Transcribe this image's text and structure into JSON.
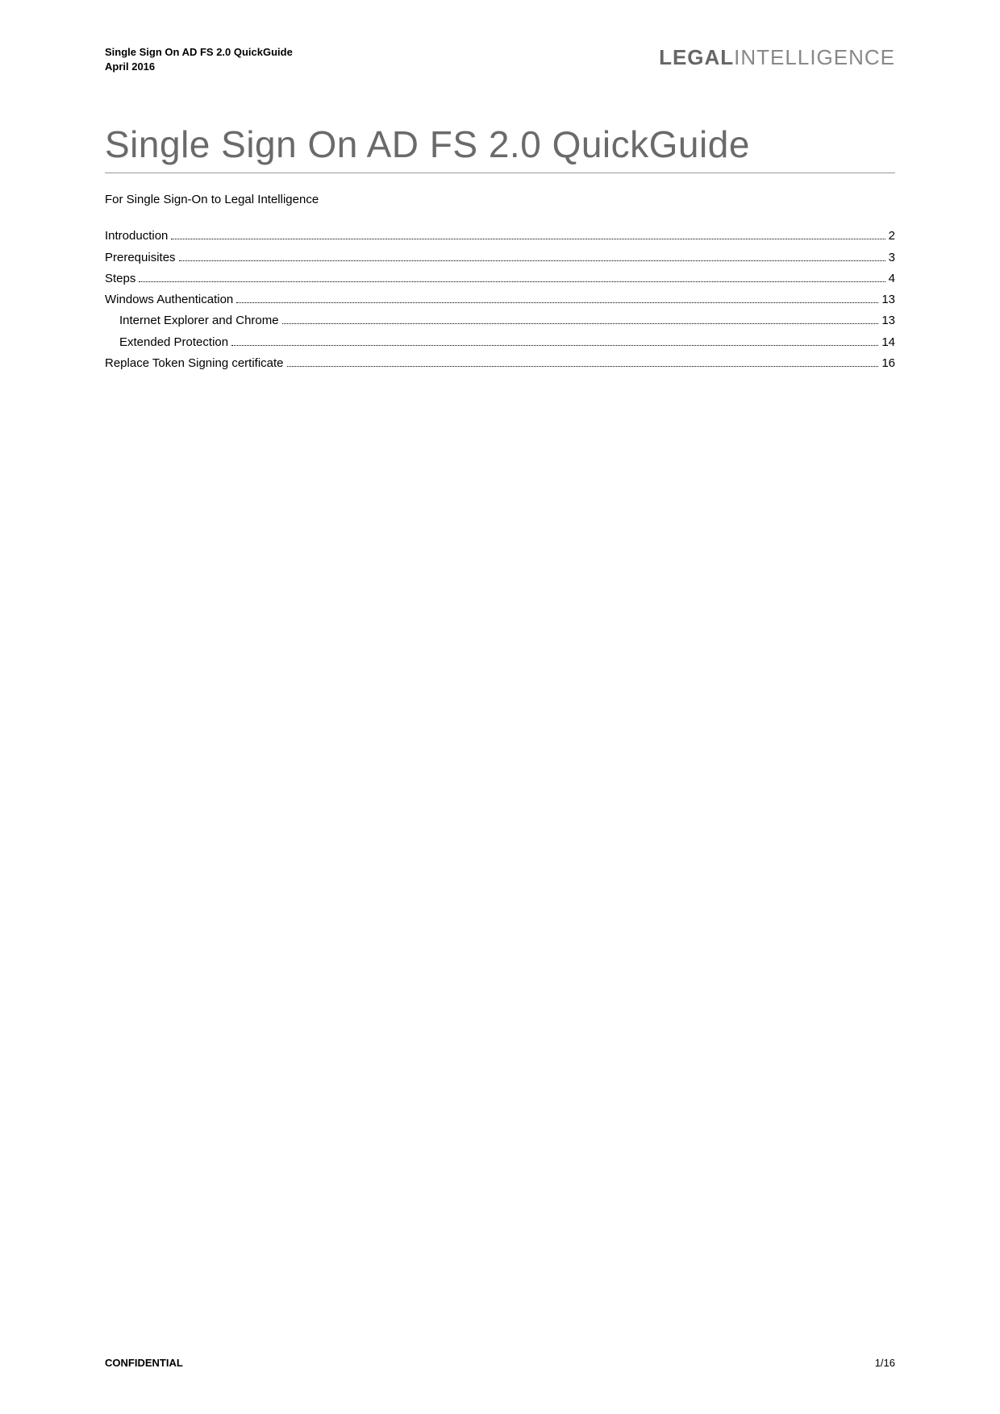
{
  "header": {
    "doc_title_line1": "Single Sign On AD FS 2.0 QuickGuide",
    "doc_title_line2": "April 2016",
    "brand_bold": "LEGAL",
    "brand_light": "INTELLIGENCE"
  },
  "title": "Single Sign On AD FS 2.0 QuickGuide",
  "subtitle": "For Single Sign-On to Legal Intelligence",
  "toc": [
    {
      "label": "Introduction",
      "page": "2",
      "indent": false
    },
    {
      "label": "Prerequisites",
      "page": "3",
      "indent": false
    },
    {
      "label": "Steps",
      "page": "4",
      "indent": false
    },
    {
      "label": "Windows Authentication",
      "page": "13",
      "indent": false
    },
    {
      "label": "Internet Explorer and Chrome",
      "page": "13",
      "indent": true
    },
    {
      "label": "Extended Protection",
      "page": "14",
      "indent": true
    },
    {
      "label": "Replace Token Signing certificate",
      "page": "16",
      "indent": false
    }
  ],
  "footer": {
    "confidential": "CONFIDENTIAL",
    "pagination": "1/16"
  }
}
